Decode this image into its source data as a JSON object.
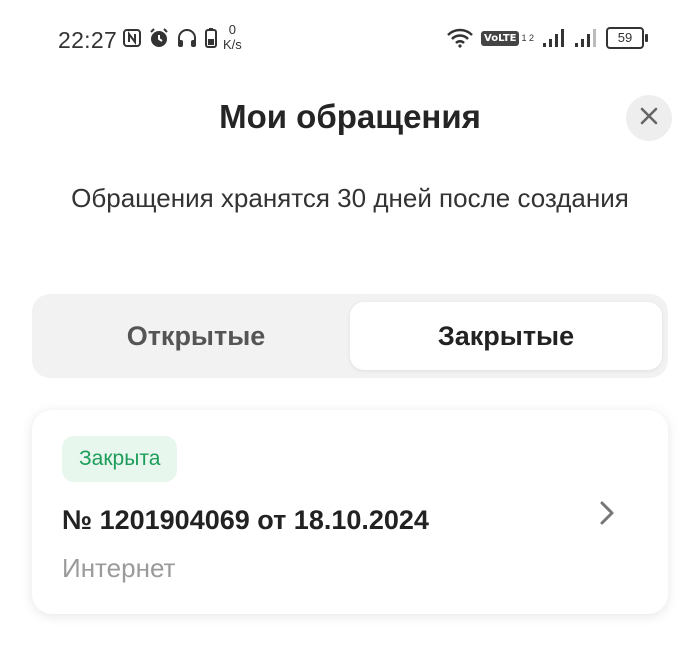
{
  "status_bar": {
    "time": "22:27",
    "net_speed_value": "0",
    "net_speed_unit": "K/s",
    "volte": "VoLTE",
    "volte_sub": "1 2",
    "battery": "59"
  },
  "header": {
    "title": "Мои обращения",
    "subtitle": "Обращения хранятся 30 дней после создания"
  },
  "tabs": [
    {
      "label": "Открытые",
      "selected": false
    },
    {
      "label": "Закрытые",
      "selected": true
    }
  ],
  "tickets": [
    {
      "status": "Закрыта",
      "title": "№ 1201904069 от 18.10.2024",
      "category": "Интернет"
    }
  ],
  "colors": {
    "status_closed_text": "#1d9c5a",
    "status_closed_bg": "#e8f7ee",
    "tabs_bg": "#f2f2f2"
  },
  "icons": [
    "nfc-icon",
    "alarm-icon",
    "headphones-icon",
    "battery-saver-icon",
    "wifi-icon",
    "signal-icon",
    "close-icon",
    "chevron-right-icon"
  ]
}
